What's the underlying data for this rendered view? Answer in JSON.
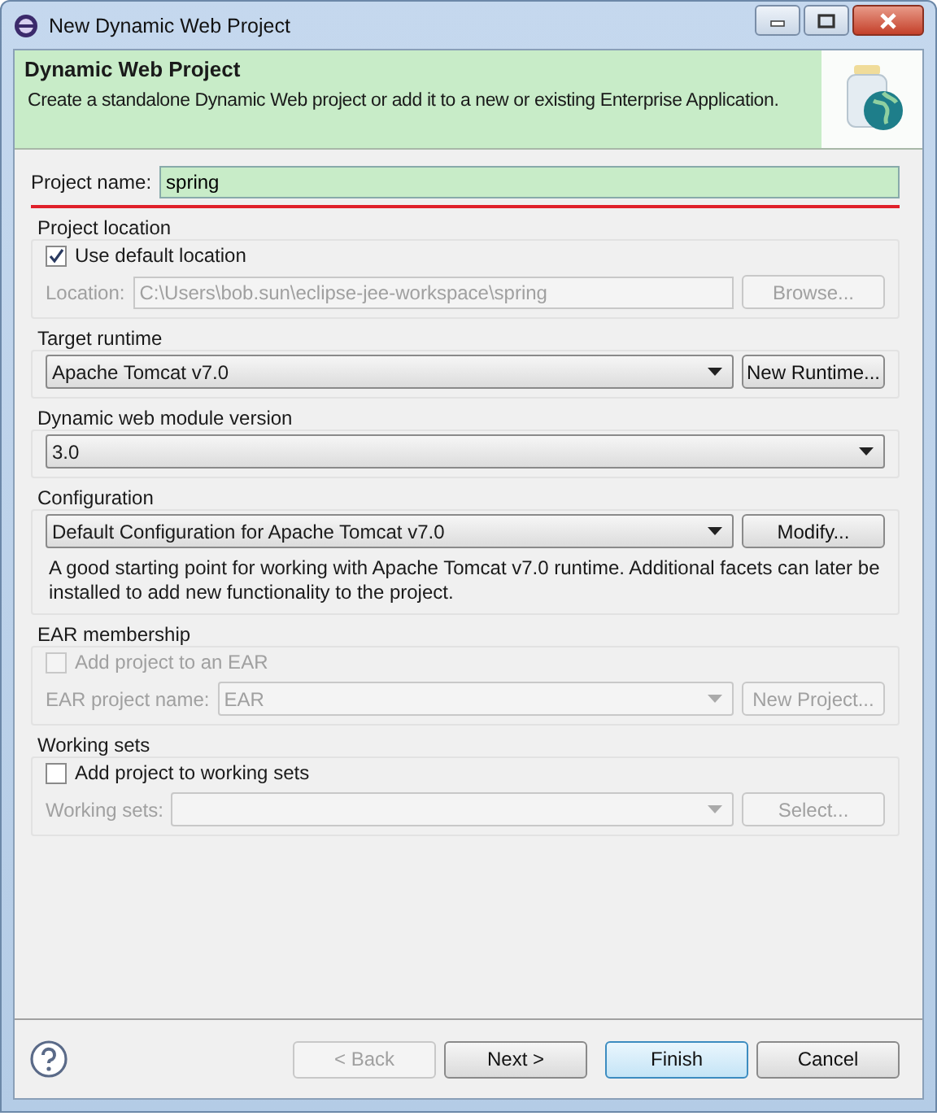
{
  "window": {
    "title": "New Dynamic Web Project"
  },
  "header": {
    "title": "Dynamic Web Project",
    "description": "Create a standalone Dynamic Web project or add it to a new or existing Enterprise Application."
  },
  "project_name": {
    "label": "Project name:",
    "value": "spring"
  },
  "project_location": {
    "title": "Project location",
    "use_default": {
      "label": "Use default location",
      "checked": true,
      "disabled": false
    },
    "location": {
      "label": "Location:",
      "value": "C:\\Users\\bob.sun\\eclipse-jee-workspace\\spring",
      "disabled": true
    },
    "button": {
      "label": "Browse...",
      "disabled": true
    }
  },
  "target_runtime": {
    "title": "Target runtime",
    "value": "Apache Tomcat v7.0",
    "disabled": false,
    "button": {
      "label": "New Runtime...",
      "disabled": false
    }
  },
  "module_version": {
    "title": "Dynamic web module version",
    "value": "3.0",
    "disabled": false
  },
  "configuration": {
    "title": "Configuration",
    "value": "Default Configuration for Apache Tomcat v7.0",
    "disabled": false,
    "button": {
      "label": "Modify...",
      "disabled": false
    },
    "description": "A good starting point for working with Apache Tomcat v7.0 runtime. Additional facets can later be installed to add new functionality to the project."
  },
  "ear_membership": {
    "title": "EAR membership",
    "checkbox": {
      "label": "Add project to an EAR",
      "checked": false,
      "disabled": true
    },
    "field": {
      "label": "EAR project name:",
      "value": "EAR",
      "disabled": true
    },
    "button": {
      "label": "New Project...",
      "disabled": true
    }
  },
  "working_sets": {
    "title": "Working sets",
    "checkbox": {
      "label": "Add project to working sets",
      "checked": false,
      "disabled": false
    },
    "field": {
      "label": "Working sets:",
      "disabled": true
    },
    "button": {
      "label": "Select...",
      "disabled": true
    }
  },
  "buttons": [
    {
      "label": "< Back",
      "disabled": true,
      "default": false
    },
    {
      "label": "Next >",
      "disabled": false,
      "default": false
    },
    {
      "label": "Finish",
      "disabled": false,
      "default": true
    },
    {
      "label": "Cancel",
      "disabled": false,
      "default": false
    }
  ]
}
